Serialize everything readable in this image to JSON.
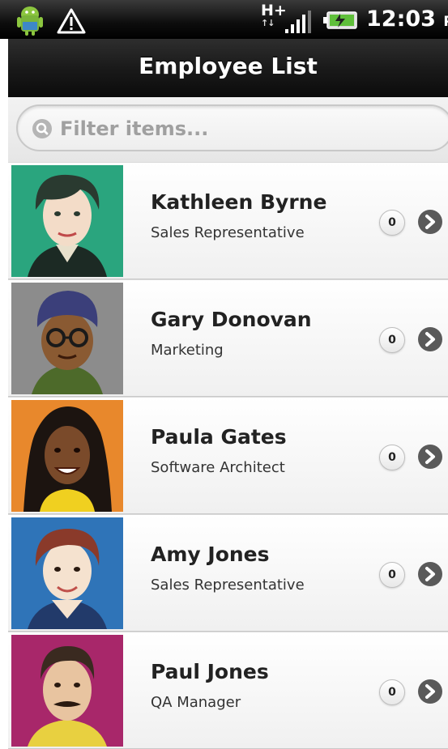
{
  "status_bar": {
    "network": "H+",
    "time": "12:03",
    "ampm": "PM"
  },
  "header": {
    "title": "Employee List"
  },
  "search": {
    "placeholder": "Filter items..."
  },
  "employees": [
    {
      "name": "Kathleen Byrne",
      "title": "Sales Representative",
      "count": "0",
      "bg": "#2aa57e"
    },
    {
      "name": "Gary Donovan",
      "title": "Marketing",
      "count": "0",
      "bg": "#8c8c8c"
    },
    {
      "name": "Paula Gates",
      "title": "Software Architect",
      "count": "0",
      "bg": "#e8882c"
    },
    {
      "name": "Amy Jones",
      "title": "Sales Representative",
      "count": "0",
      "bg": "#2f74b8"
    },
    {
      "name": "Paul Jones",
      "title": "QA Manager",
      "count": "0",
      "bg": "#a8276a"
    }
  ],
  "icons": {
    "status_left": [
      "android-icon",
      "warning-icon"
    ],
    "status_right": [
      "signal-icon",
      "battery-icon"
    ],
    "search": "search-icon",
    "row_action": "chevron-right-icon"
  }
}
